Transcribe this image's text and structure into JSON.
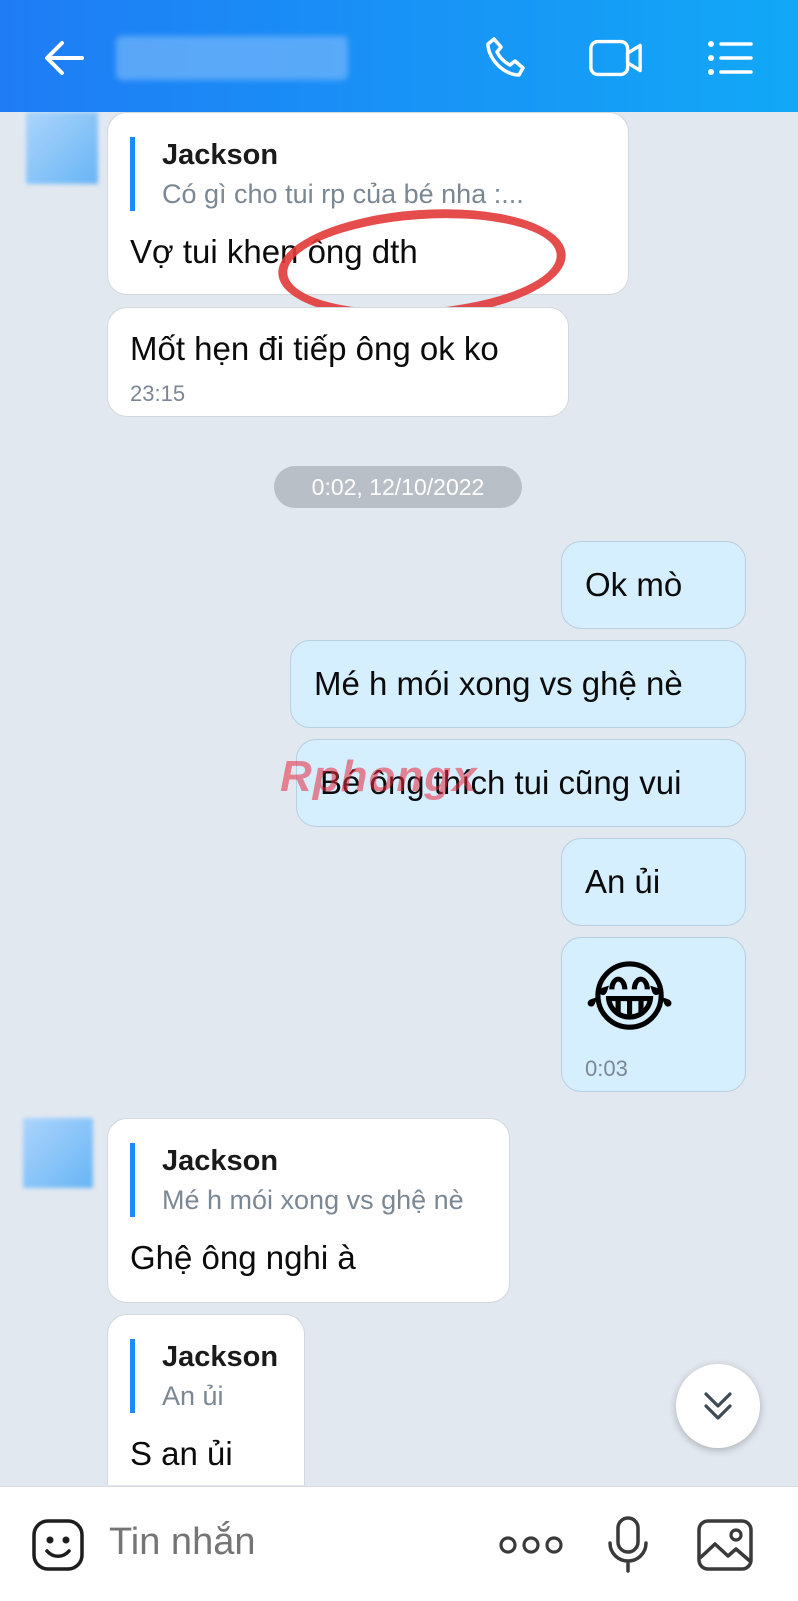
{
  "header": {
    "back_icon": "back-arrow-icon",
    "contact_name": "",
    "call_icon": "phone-icon",
    "video_icon": "video-camera-icon",
    "menu_icon": "list-menu-icon"
  },
  "messages": {
    "m1": {
      "quote_name": "Jackson",
      "quote_text": "Có gì cho tui rp của bé          nha :...",
      "text": "Vợ tui khen ông dth"
    },
    "m2": {
      "text": "Mốt hẹn đi tiếp ông ok ko",
      "time": "23:15"
    },
    "date_chip": "0:02, 12/10/2022",
    "m3": {
      "text": "Ok mò"
    },
    "m4": {
      "text": "Mé h mói xong vs ghệ nè"
    },
    "m5": {
      "text": "Bé ông thích tui cũng vui"
    },
    "m6": {
      "text": "An ủi"
    },
    "m7": {
      "emoji": "😂",
      "time": "0:03"
    },
    "m8": {
      "quote_name": "Jackson",
      "quote_text": "Mé h mói xong vs ghệ nè",
      "text": "Ghệ ông nghi à"
    },
    "m9": {
      "quote_name": "Jackson",
      "quote_text": "An ủi",
      "text": "S an ủi"
    }
  },
  "watermark": "Rphongx",
  "scroll_down_icon": "double-chevron-down-icon",
  "composer": {
    "sticker_icon": "sticker-face-icon",
    "placeholder": "Tin nhắn",
    "more_icon": "more-dots-icon",
    "mic_icon": "microphone-icon",
    "image_icon": "image-gallery-icon"
  },
  "colors": {
    "header_start": "#1f7cf5",
    "header_end": "#12a8f7",
    "chat_bg": "#e2e8f0",
    "outgoing_bubble": "#d6efff",
    "quote_bar": "#1a8cff"
  }
}
